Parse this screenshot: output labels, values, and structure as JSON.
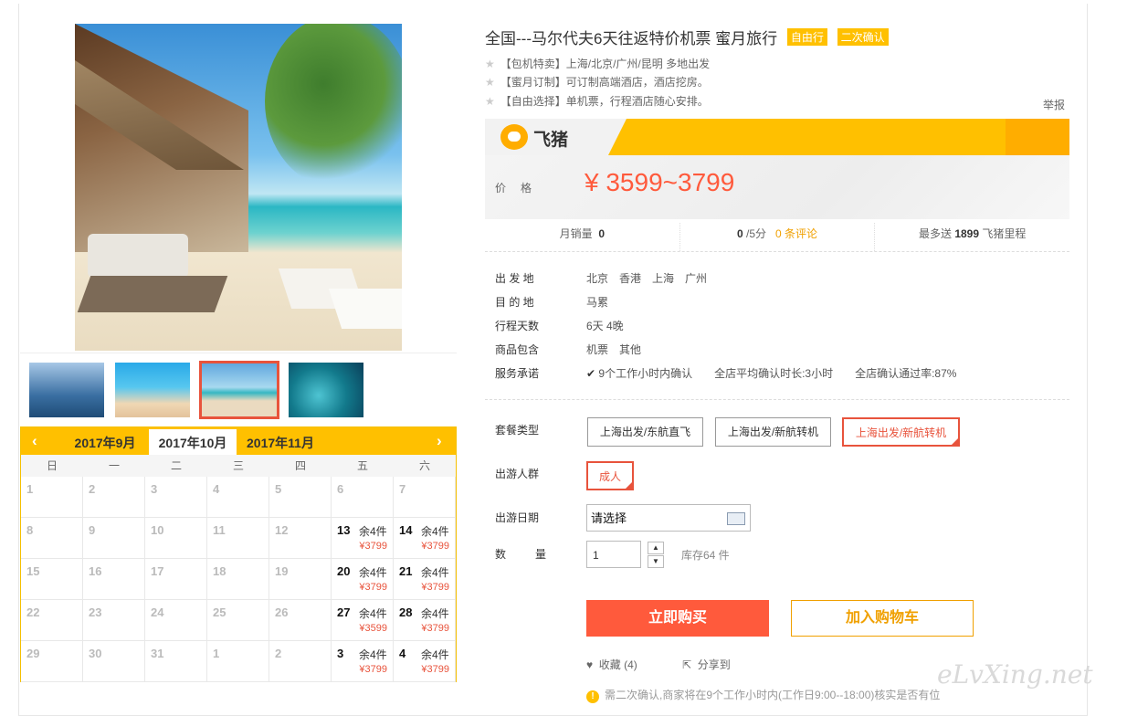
{
  "product": {
    "title": "全国---马尔代夫6天往返特价机票 蜜月旅行",
    "tags": [
      "自由行",
      "二次确认"
    ],
    "features": [
      "【包机特卖】上海/北京/广州/昆明 多地出发",
      "【蜜月订制】可订制高端酒店，酒店挖房。",
      "【自由选择】单机票，行程酒店随心安排。"
    ],
    "report": "举报"
  },
  "brand": {
    "name": "飞猪",
    "icon": "pig-logo-icon",
    "accent": "#ffc000"
  },
  "price": {
    "label": "价格",
    "value": "¥ 3599~3799",
    "color": "#ff5a3c"
  },
  "stats": {
    "sales_label": "月销量",
    "sales_value": "0",
    "rating_value": "0",
    "rating_suffix": "/5分",
    "reviews": "0 条评论",
    "mileage_prefix": "最多送",
    "mileage_value": "1899",
    "mileage_suffix": "飞猪里程"
  },
  "info": [
    {
      "label": "出 发 地",
      "value": "北京　香港　上海　广州"
    },
    {
      "label": "目 的 地",
      "value": "马累"
    },
    {
      "label": "行程天数",
      "value": "6天 4晚"
    },
    {
      "label": "商品包含",
      "value": "机票　其他"
    },
    {
      "label": "服务承诺",
      "value": "9个工作小时内确认　　全店平均确认时长:3小时　　全店确认通过率:87%"
    }
  ],
  "options": {
    "package_label": "套餐类型",
    "packages": [
      "上海出发/东航直飞",
      "上海出发/新航转机",
      "上海出发/新航转机"
    ],
    "selected_package": 2,
    "group_label": "出游人群",
    "group": "成人",
    "date_label": "出游日期",
    "date_value": "请选择",
    "qty_label": "数　量",
    "qty_value": "1",
    "stock": "库存64 件"
  },
  "actions": {
    "buy": "立即购买",
    "cart": "加入购物车",
    "favorite": "收藏 (4)",
    "share": "分享到"
  },
  "notice": "需二次确认,商家将在9个工作小时内(工作日9:00--18:00)核实是否有位",
  "watermark": "eLvXing.net",
  "calendar": {
    "months": [
      "2017年9月",
      "2017年10月",
      "2017年11月"
    ],
    "active_month": 1,
    "weekdays": [
      "日",
      "一",
      "二",
      "三",
      "四",
      "五",
      "六"
    ],
    "rows": [
      [
        {
          "d": "1"
        },
        {
          "d": "2"
        },
        {
          "d": "3"
        },
        {
          "d": "4"
        },
        {
          "d": "5"
        },
        {
          "d": "6"
        },
        {
          "d": "7"
        }
      ],
      [
        {
          "d": "8"
        },
        {
          "d": "9"
        },
        {
          "d": "10"
        },
        {
          "d": "11"
        },
        {
          "d": "12"
        },
        {
          "d": "13",
          "stock": "余4件",
          "price": "¥3799"
        },
        {
          "d": "14",
          "stock": "余4件",
          "price": "¥3799"
        }
      ],
      [
        {
          "d": "15"
        },
        {
          "d": "16"
        },
        {
          "d": "17"
        },
        {
          "d": "18"
        },
        {
          "d": "19"
        },
        {
          "d": "20",
          "stock": "余4件",
          "price": "¥3799"
        },
        {
          "d": "21",
          "stock": "余4件",
          "price": "¥3799"
        }
      ],
      [
        {
          "d": "22"
        },
        {
          "d": "23"
        },
        {
          "d": "24"
        },
        {
          "d": "25"
        },
        {
          "d": "26"
        },
        {
          "d": "27",
          "stock": "余4件",
          "price": "¥3599"
        },
        {
          "d": "28",
          "stock": "余4件",
          "price": "¥3799"
        }
      ],
      [
        {
          "d": "29"
        },
        {
          "d": "30"
        },
        {
          "d": "31"
        },
        {
          "d": "1"
        },
        {
          "d": "2"
        },
        {
          "d": "3",
          "stock": "余4件",
          "price": "¥3799"
        },
        {
          "d": "4",
          "stock": "余4件",
          "price": "¥3799"
        }
      ]
    ]
  }
}
